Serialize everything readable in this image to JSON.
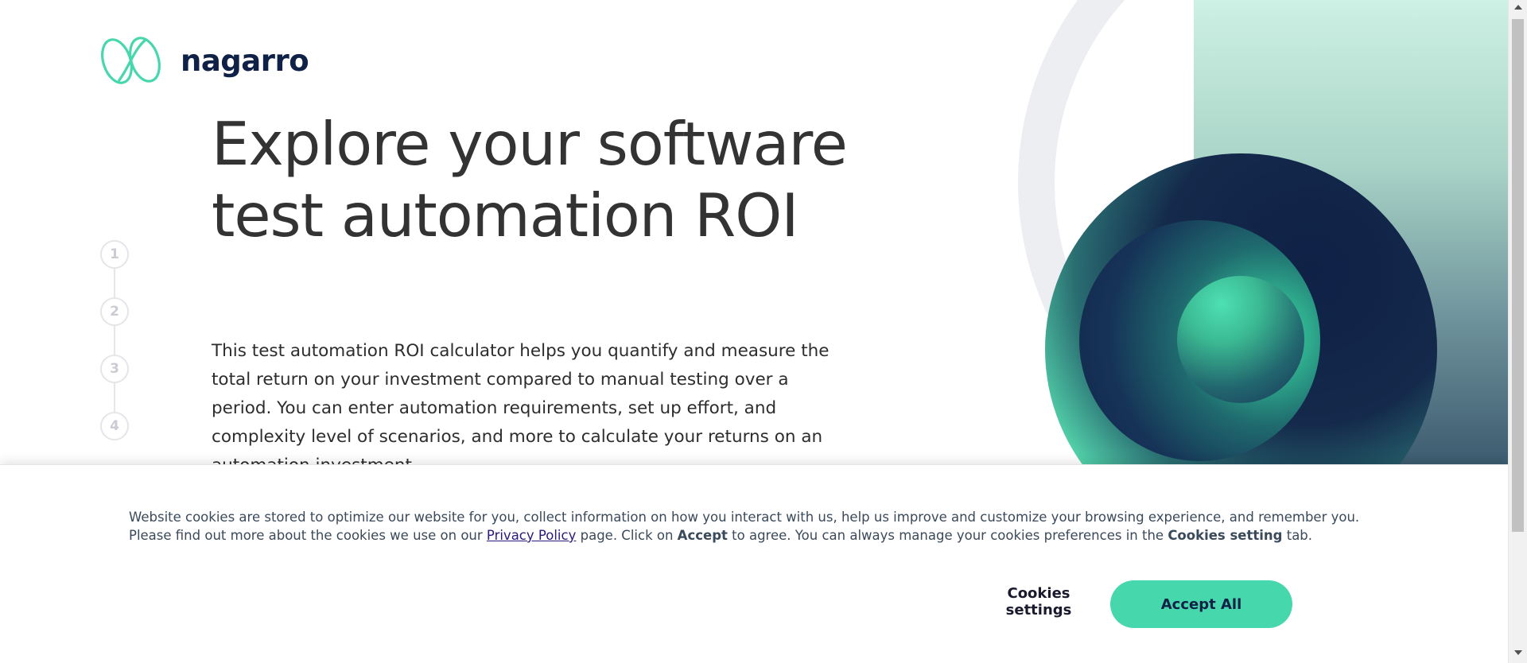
{
  "brand": {
    "name": "nagarro",
    "accent_color": "#47d7ac",
    "dark_color": "#0f2146"
  },
  "steps": [
    "1",
    "2",
    "3",
    "4"
  ],
  "hero": {
    "title": "Explore your software test automation ROI",
    "description": "This test automation ROI calculator helps you quantify and measure the total return on your investment compared to manual testing over a period. You can enter automation requirements, set up effort, and complexity level of scenarios, and more to calculate your returns on an automation investment."
  },
  "cookie_banner": {
    "text_part1": "Website cookies are stored to optimize our website for you, collect information on how you interact with us, help us improve and customize your browsing experience, and remember you. Please find out more about the cookies we use on our ",
    "privacy_link": "Privacy Policy",
    "text_part2": " page. Click on ",
    "accept_word": "Accept",
    "text_part3": " to agree. You can always manage your cookies preferences in the ",
    "settings_word": "Cookies setting",
    "text_part4": " tab.",
    "settings_button": "Cookies settings",
    "accept_button": "Accept All"
  }
}
